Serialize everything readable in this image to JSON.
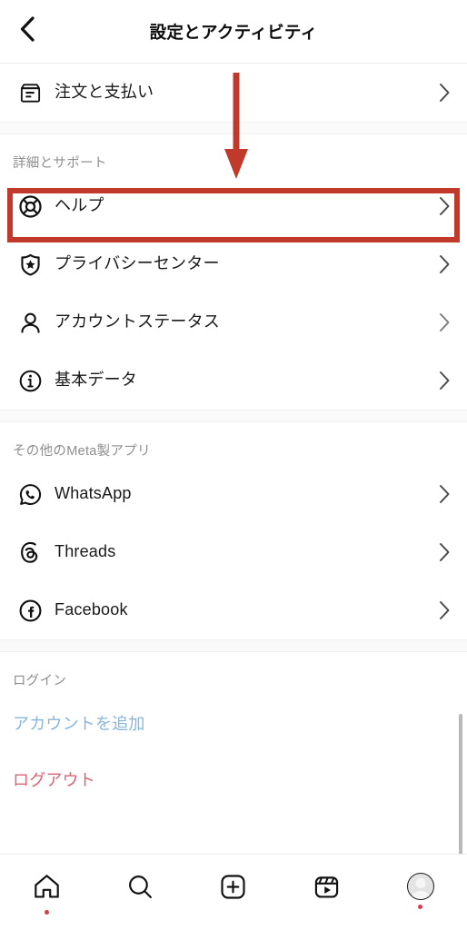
{
  "header": {
    "title": "設定とアクティビティ",
    "back_icon": "chevron-left-icon"
  },
  "sections": [
    {
      "id": "orders",
      "header": null,
      "items": [
        {
          "id": "orders-payments",
          "label": "注文と支払い",
          "icon": "box-icon",
          "chevron": "chevron-right-icon"
        }
      ]
    },
    {
      "id": "support",
      "header": "詳細とサポート",
      "items": [
        {
          "id": "help",
          "label": "ヘルプ",
          "icon": "lifebuoy-icon",
          "chevron": "chevron-right-icon",
          "highlighted": true
        },
        {
          "id": "privacy-center",
          "label": "プライバシーセンター",
          "icon": "shield-star-icon",
          "chevron": "chevron-right-icon"
        },
        {
          "id": "account-status",
          "label": "アカウントステータス",
          "icon": "person-icon",
          "chevron": "chevron-right-icon"
        },
        {
          "id": "basic-data",
          "label": "基本データ",
          "icon": "info-circle-icon",
          "chevron": "chevron-right-icon"
        }
      ]
    },
    {
      "id": "meta-apps",
      "header": "その他のMeta製アプリ",
      "items": [
        {
          "id": "whatsapp",
          "label": "WhatsApp",
          "icon": "whatsapp-icon",
          "chevron": "chevron-right-icon"
        },
        {
          "id": "threads",
          "label": "Threads",
          "icon": "threads-icon",
          "chevron": "chevron-right-icon"
        },
        {
          "id": "facebook",
          "label": "Facebook",
          "icon": "facebook-icon",
          "chevron": "chevron-right-icon"
        }
      ]
    },
    {
      "id": "login",
      "header": "ログイン",
      "actions": [
        {
          "id": "add-account",
          "label": "アカウントを追加",
          "color": "#8AB6DC"
        },
        {
          "id": "logout",
          "label": "ログアウト",
          "color": "#D96377"
        }
      ]
    }
  ],
  "annotation": {
    "arrow_color": "#C0392B",
    "box_color": "#C0392B",
    "points_to": "help",
    "arrow_icon": "down-arrow-annotation",
    "box_icon": "highlight-box-annotation"
  },
  "scrollbar": {
    "color": "#b9b9b9"
  },
  "bottom_nav": {
    "items": [
      {
        "id": "home",
        "icon": "home-icon",
        "badge_dot": true
      },
      {
        "id": "search",
        "icon": "search-icon",
        "badge_dot": false
      },
      {
        "id": "create",
        "icon": "plus-square-icon",
        "badge_dot": false
      },
      {
        "id": "reels",
        "icon": "reels-icon",
        "badge_dot": false
      },
      {
        "id": "profile",
        "icon": "avatar-icon",
        "badge_dot": true
      }
    ],
    "dot_color": "#d93b4b"
  },
  "colors": {
    "section_header": "#8e8e8e",
    "row_label": "#191919",
    "divider": "#efefef",
    "band_bg": "#fafafa",
    "accent_red": "#C0392B"
  }
}
